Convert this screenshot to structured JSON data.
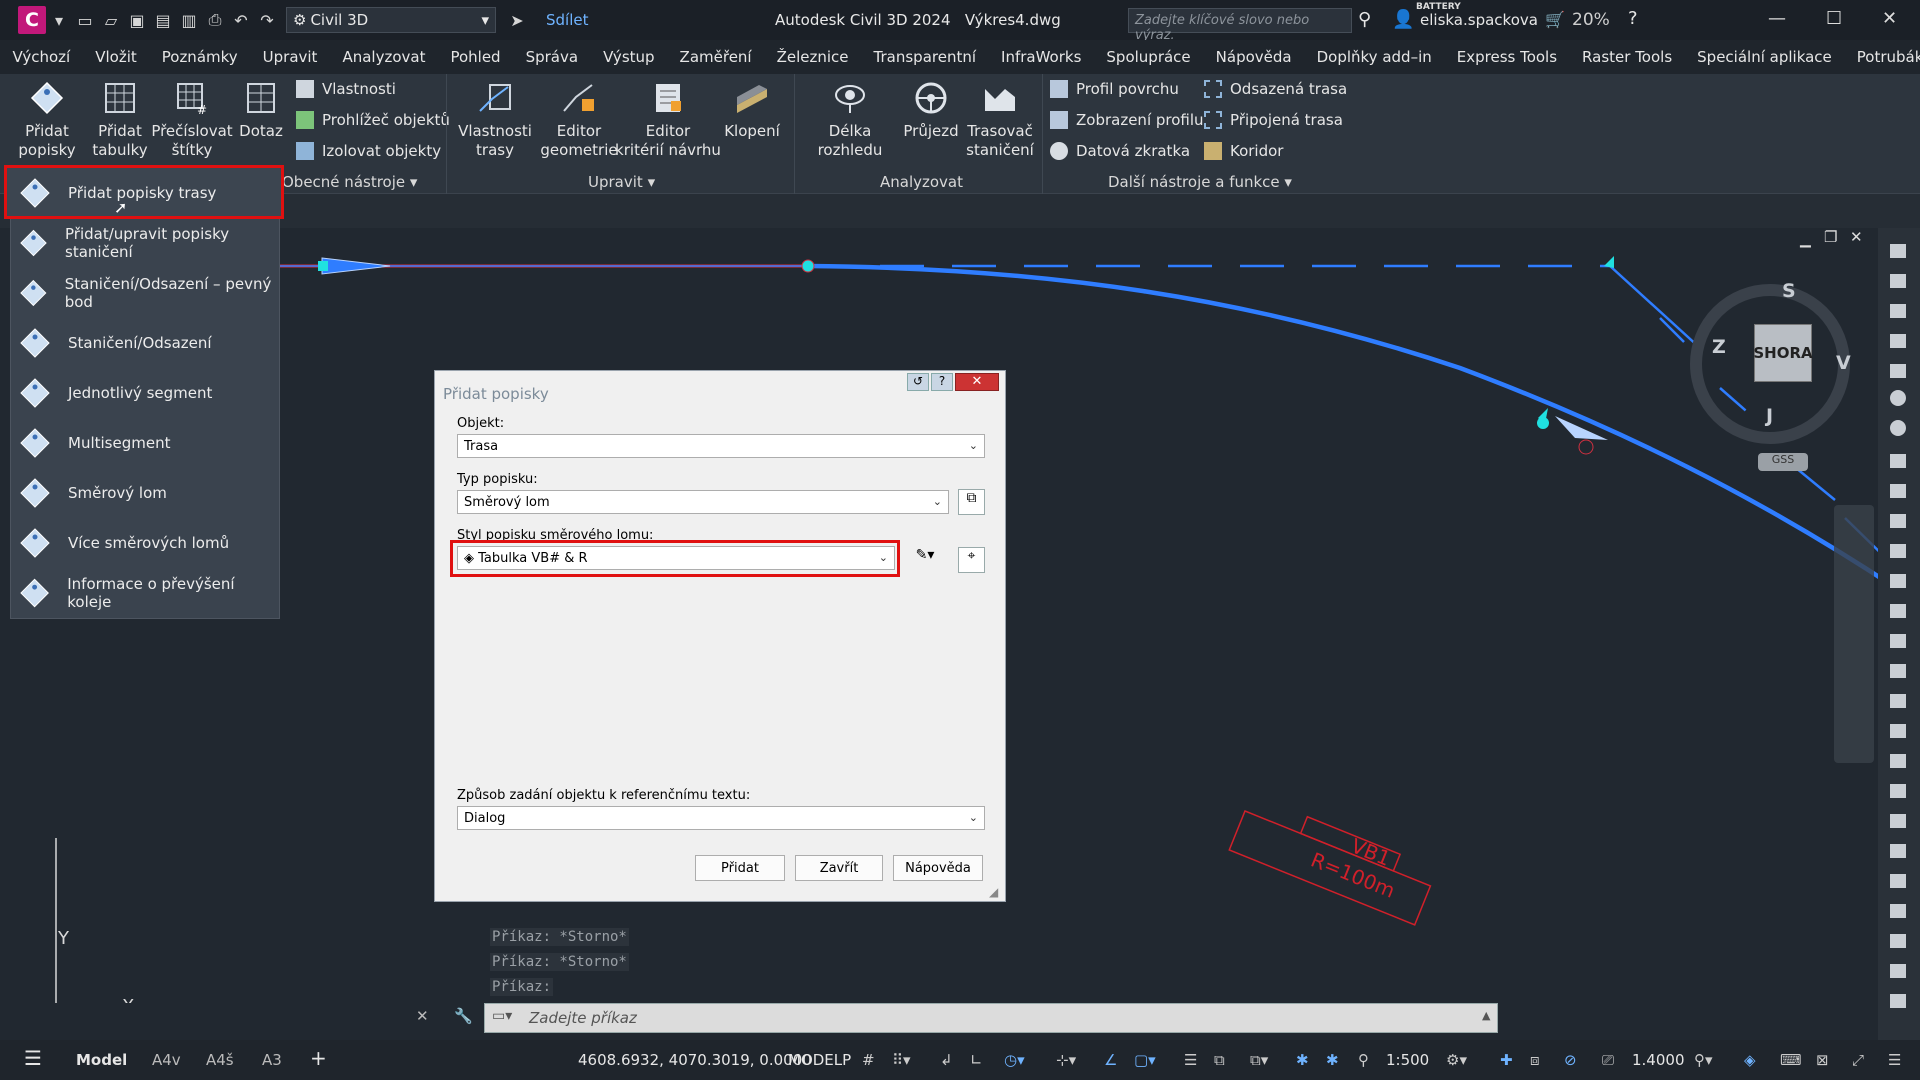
{
  "titlebar": {
    "logo_letter": "C",
    "workspace": "Civil 3D",
    "share": "Sdílet",
    "app_title": "Autodesk Civil 3D 2024",
    "file_name": "Výkres4.dwg",
    "search_placeholder": "Zadejte klíčové slovo nebo výraz.",
    "battery_label": "BATTERY",
    "battery_pct": "20%",
    "user": "eliska.spackova"
  },
  "menu": [
    "Výchozí",
    "Vložit",
    "Poznámky",
    "Upravit",
    "Analyzovat",
    "Pohled",
    "Správa",
    "Výstup",
    "Zaměření",
    "Železnice",
    "Transparentní",
    "InfraWorks",
    "Spolupráce",
    "Nápověda",
    "Doplňky add–in",
    "Express Tools",
    "Raster Tools",
    "Speciální aplikace",
    "Potrubák"
  ],
  "ribbon": {
    "big": {
      "add_labels": "Přidat\npopisky",
      "add_tables": "Přidat\ntabulky",
      "renumber": "Přečíslovat\nštítky",
      "query": "Dotaz",
      "alignment_props": "Vlastnosti\ntrasy",
      "geometry_editor": "Editor\ngeometrie",
      "design_criteria": "Editor\nkritérií návrhu",
      "superelevation": "Klopení",
      "sight_distance": "Délka rozhledu",
      "drive": "Průjezd",
      "station_tracker": "Trasovač\nstaničení"
    },
    "small": {
      "properties": "Vlastnosti",
      "object_viewer": "Prohlížeč objektů",
      "isolate": "Izolovat objekty",
      "surface_profile": "Profil povrchu",
      "profile_view": "Zobrazení profilu",
      "data_shortcut": "Datová zkratka",
      "offset_alignment": "Odsazená trasa",
      "connected_alignment": "Připojená trasa",
      "corridor": "Koridor"
    },
    "panels": {
      "general": "Obecné nástroje",
      "modify": "Upravit",
      "analyze": "Analyzovat",
      "more": "Další nástroje a funkce"
    }
  },
  "dropdown": [
    "Přidat popisky trasy",
    "Přidat/upravit popisky staničení",
    "Staničení/Odsazení – pevný bod",
    "Staničení/Odsazení",
    "Jednotlivý segment",
    "Multisegment",
    "Směrový lom",
    "Více směrových lomů",
    "Informace o převýšení koleje"
  ],
  "dialog": {
    "title": "Přidat popisky",
    "object_label": "Objekt:",
    "object_value": "Trasa",
    "type_label": "Typ popisku:",
    "type_value": "Směrový lom",
    "style_label": "Styl popisku směrového lomu:",
    "style_value": "Tabulka VB# & R",
    "ref_label": "Způsob zadání objektu k referenčnímu textu:",
    "ref_value": "Dialog",
    "btn_add": "Přidat",
    "btn_close": "Zavřít",
    "btn_help": "Nápověda"
  },
  "viewcube": {
    "top": "SHORA",
    "n": "S",
    "e": "V",
    "s": "J",
    "w": "Z",
    "ucs": "GSS"
  },
  "drawing": {
    "label_name": "VB1",
    "label_radius": "R=100m"
  },
  "ucs": {
    "x": "X",
    "y": "Y"
  },
  "command": {
    "history": [
      "Příkaz: *Storno*",
      "Příkaz: *Storno*",
      "Příkaz:"
    ],
    "placeholder": "Zadejte příkaz"
  },
  "status": {
    "tabs": [
      "Model",
      "A4v",
      "A4š",
      "A3"
    ],
    "coords": "4608.6932, 4070.3019, 0.0000",
    "mode": "MODELP",
    "scale": "1:500",
    "value": "1.4000"
  },
  "colors": {
    "alignment": "#2f7dff",
    "highlight": "#e01010",
    "label": "#d0202a"
  }
}
